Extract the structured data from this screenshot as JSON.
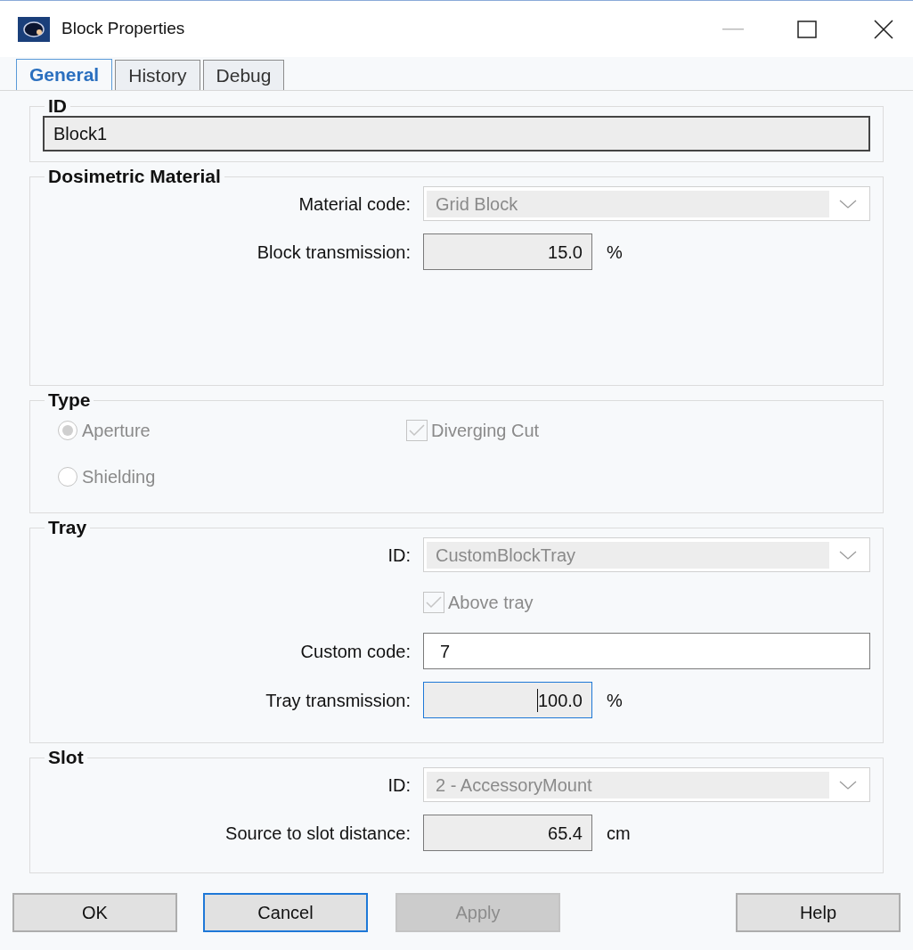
{
  "window": {
    "title": "Block Properties"
  },
  "tabs": [
    {
      "label": "General",
      "selected": true
    },
    {
      "label": "History",
      "selected": false
    },
    {
      "label": "Debug",
      "selected": false
    }
  ],
  "groups": [
    {
      "title": "ID",
      "rows": [
        {
          "kind": "wide",
          "value": "Block1",
          "disabled": true
        }
      ]
    },
    {
      "title": "Dosimetric Material",
      "rows": [
        {
          "kind": "combo",
          "label": "Material code:",
          "value": "Grid Block",
          "disabled": true
        },
        {
          "kind": "number",
          "label": "Block transmission:",
          "value": "15.0",
          "unit": "%",
          "focused": false
        }
      ]
    },
    {
      "title": "Type",
      "rows": [
        {
          "kind": "options",
          "items": [
            {
              "kind": "radio",
              "label": "Aperture",
              "checked": true,
              "disabled": true
            },
            {
              "kind": "checkbox",
              "label": "Diverging Cut",
              "checked": true,
              "disabled": true
            },
            {
              "kind": "radio",
              "label": "Shielding",
              "checked": false,
              "disabled": true
            }
          ]
        }
      ]
    },
    {
      "title": "Tray",
      "rows": [
        {
          "kind": "combo",
          "label": "ID:",
          "value": "CustomBlockTray",
          "disabled": true
        },
        {
          "kind": "checkbox",
          "label": "Above tray",
          "checked": true,
          "disabled": true
        },
        {
          "kind": "text",
          "label": "Custom code:",
          "value": "7"
        },
        {
          "kind": "number",
          "label": "Tray transmission:",
          "value": "100.0",
          "unit": "%",
          "focused": true
        }
      ]
    },
    {
      "title": "Slot",
      "rows": [
        {
          "kind": "combo",
          "label": "ID:",
          "value": "2 - AccessoryMount",
          "disabled": true
        },
        {
          "kind": "number",
          "label": "Source to slot distance:",
          "value": "65.4",
          "unit": "cm",
          "focused": false
        }
      ]
    }
  ],
  "buttons": [
    {
      "label": "OK",
      "default": false,
      "disabled": false
    },
    {
      "label": "Cancel",
      "default": true,
      "disabled": false
    },
    {
      "label": "Apply",
      "default": false,
      "disabled": true
    },
    {
      "label": "Help",
      "default": false,
      "disabled": false
    }
  ]
}
